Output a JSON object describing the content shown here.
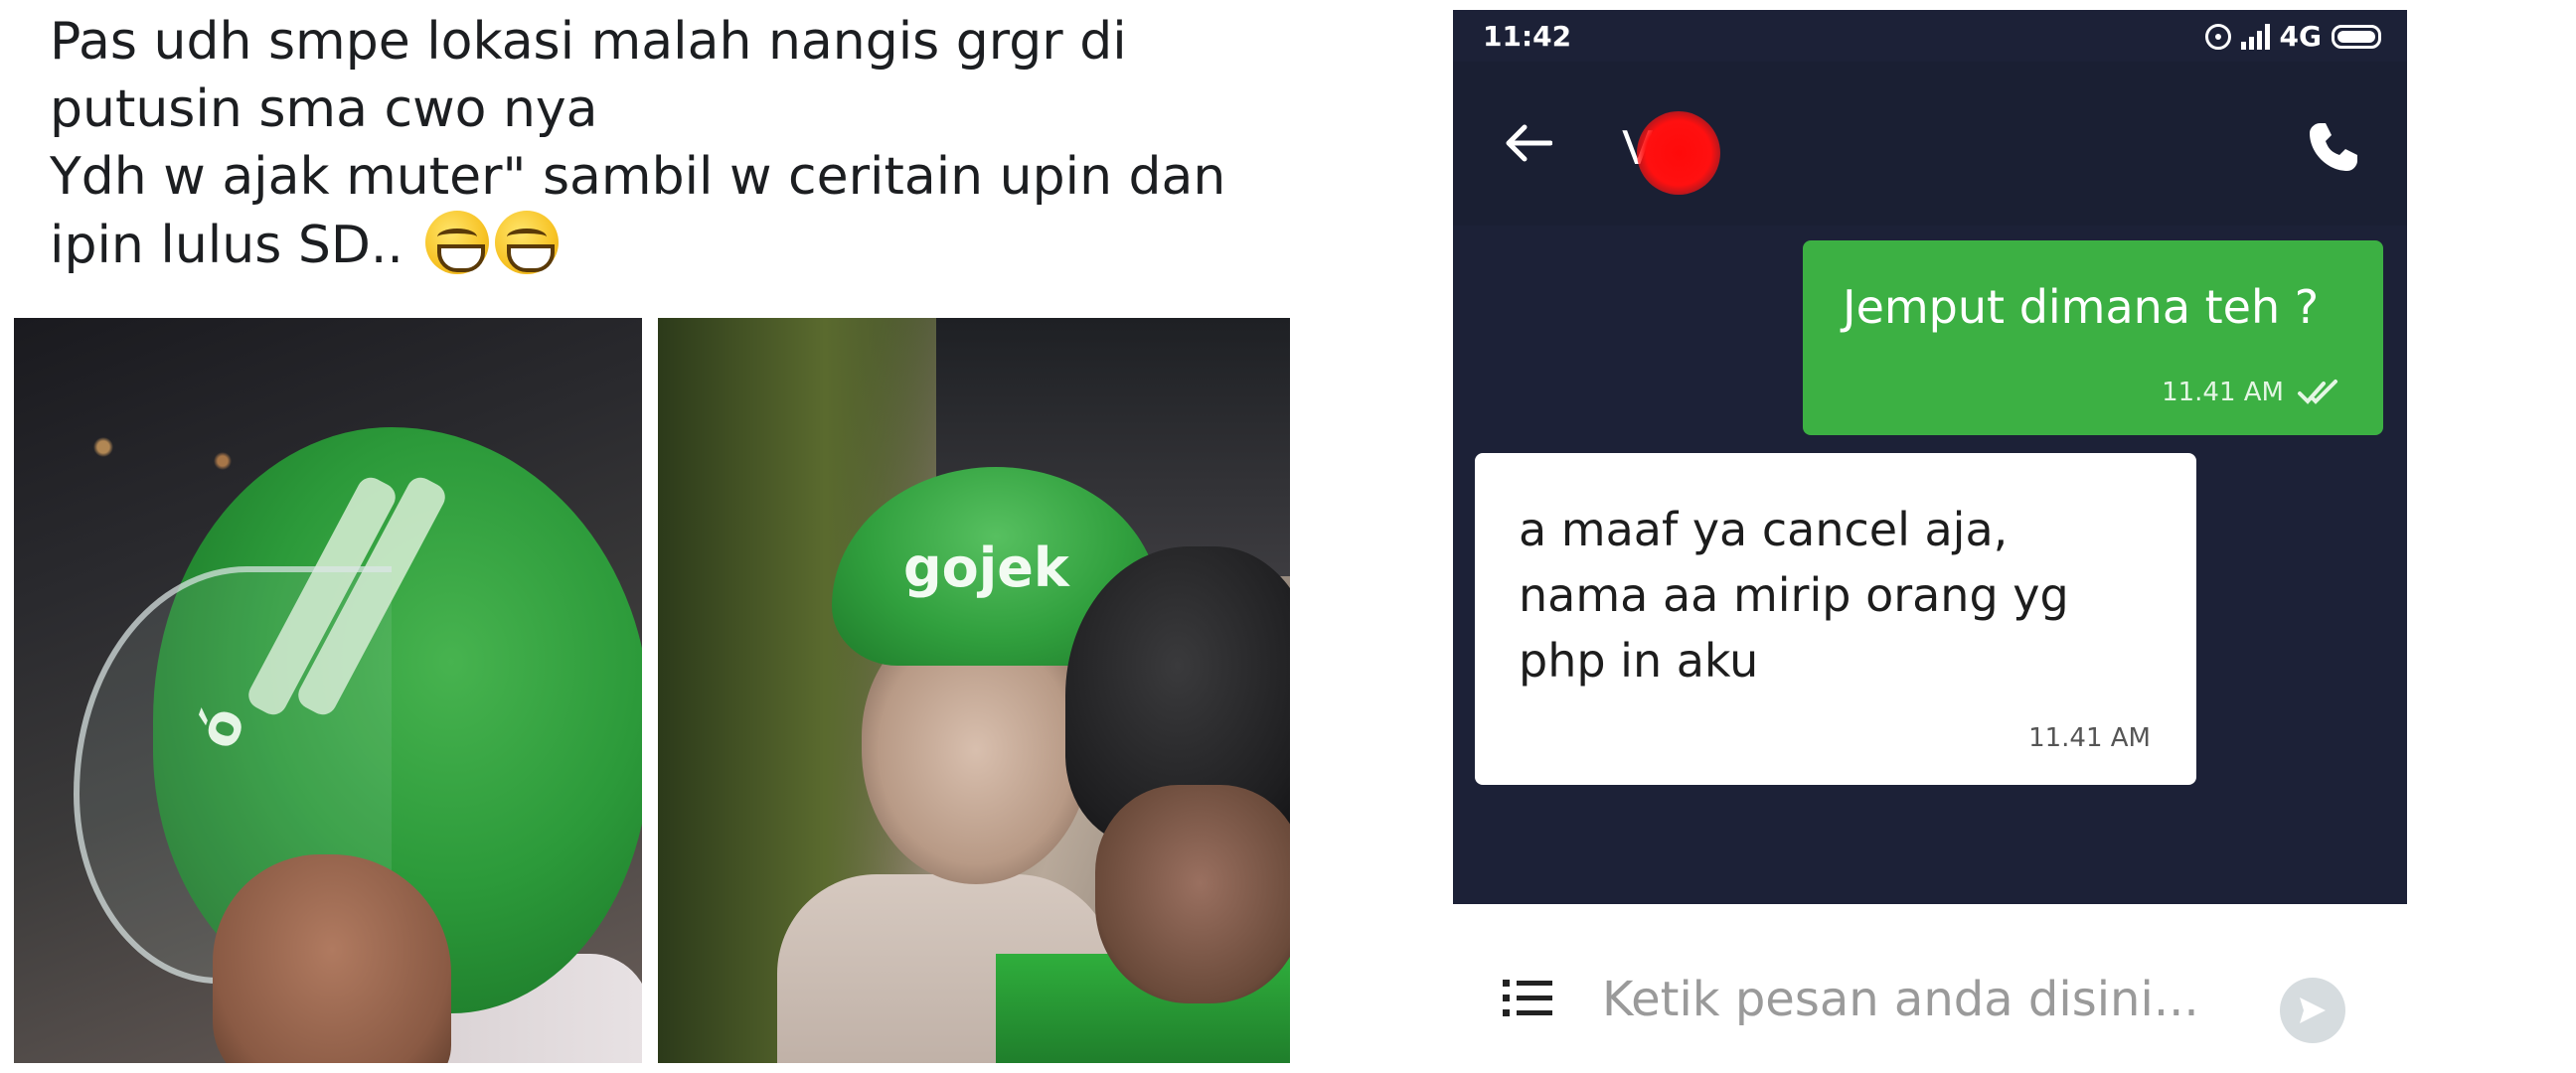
{
  "post": {
    "caption_lines": [
      "Pas udh smpe lokasi malah nangis grgr di",
      "putusin sma cwo nya",
      "Ydh w ajak muter\" sambil w ceritain upin dan",
      "ipin lulus SD.."
    ],
    "emojis": [
      "grinning-squinting-face-icon",
      "grinning-squinting-face-icon"
    ],
    "photo_1_logo": "ó",
    "photo_2_logo": "gojek"
  },
  "chat": {
    "status_bar": {
      "time": "11:42",
      "network": "4G",
      "icons": [
        "hotspot-icon",
        "signal-icon",
        "battery-icon"
      ]
    },
    "header": {
      "contact_name": "Vira",
      "icons": [
        "back-arrow-icon",
        "phone-call-icon"
      ]
    },
    "messages": [
      {
        "direction": "outgoing",
        "text": "Jemput dimana teh ?",
        "time": "11.41 AM",
        "status": "read"
      },
      {
        "direction": "incoming",
        "lines": [
          "a maaf ya cancel aja,",
          "nama aa mirip orang yg",
          "php in aku"
        ],
        "time": "11.41 AM"
      }
    ],
    "input": {
      "placeholder": "Ketik pesan anda disini...",
      "icons": [
        "menu-list-icon",
        "send-icon"
      ]
    },
    "colors": {
      "background": "#1c2137",
      "outgoing_bubble": "#3cb043",
      "incoming_bubble": "#ffffff",
      "redaction": "#ff1010"
    }
  }
}
